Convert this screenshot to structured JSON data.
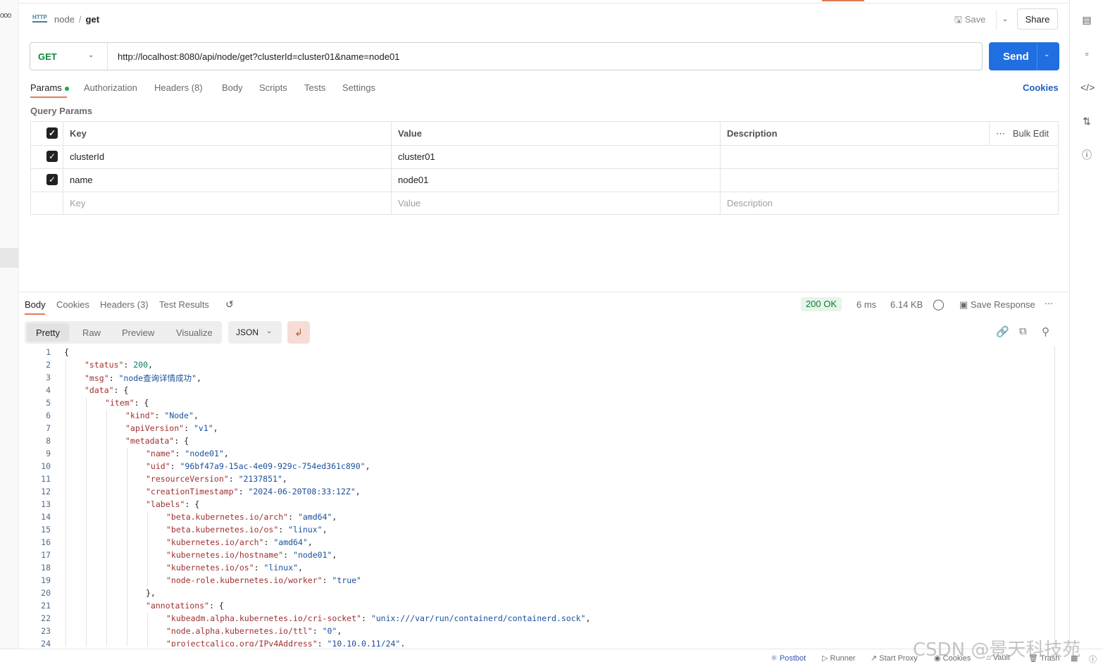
{
  "header": {
    "http_icon": "HTTP",
    "crumb_parent": "node",
    "crumb_sep": "/",
    "crumb_current": "get",
    "save_label": "Save",
    "share_label": "Share"
  },
  "request": {
    "method": "GET",
    "url": "http://localhost:8080/api/node/get?clusterId=cluster01&name=node01",
    "send_label": "Send",
    "tabs": [
      "Params",
      "Authorization",
      "Headers (8)",
      "Body",
      "Scripts",
      "Tests",
      "Settings"
    ],
    "cookies_label": "Cookies"
  },
  "params": {
    "title": "Query Params",
    "headers": [
      "Key",
      "Value",
      "Description"
    ],
    "bulk_edit": "Bulk Edit",
    "rows": [
      {
        "key": "clusterId",
        "value": "cluster01",
        "description": ""
      },
      {
        "key": "name",
        "value": "node01",
        "description": ""
      }
    ],
    "placeholder": {
      "key": "Key",
      "value": "Value",
      "description": "Description"
    }
  },
  "response": {
    "tabs": [
      "Body",
      "Cookies",
      "Headers (3)",
      "Test Results"
    ],
    "status": "200 OK",
    "time": "6 ms",
    "size": "6.14 KB",
    "save_response": "Save Response",
    "formats": [
      "Pretty",
      "Raw",
      "Preview",
      "Visualize"
    ],
    "format_type": "JSON"
  },
  "code_lines": [
    {
      "n": "1",
      "indent": 0,
      "html": "{"
    },
    {
      "n": "2",
      "indent": 1,
      "html": "<span class='k'>\"status\"</span>: <span class='n'>200</span>,"
    },
    {
      "n": "3",
      "indent": 1,
      "html": "<span class='k'>\"msg\"</span>: <span class='s'>\"node查询详情成功\"</span>,"
    },
    {
      "n": "4",
      "indent": 1,
      "html": "<span class='k'>\"data\"</span>: {"
    },
    {
      "n": "5",
      "indent": 2,
      "html": "<span class='k'>\"item\"</span>: {"
    },
    {
      "n": "6",
      "indent": 3,
      "html": "<span class='k'>\"kind\"</span>: <span class='s'>\"Node\"</span>,"
    },
    {
      "n": "7",
      "indent": 3,
      "html": "<span class='k'>\"apiVersion\"</span>: <span class='s'>\"v1\"</span>,"
    },
    {
      "n": "8",
      "indent": 3,
      "html": "<span class='k'>\"metadata\"</span>: {"
    },
    {
      "n": "9",
      "indent": 4,
      "html": "<span class='k'>\"name\"</span>: <span class='s'>\"node01\"</span>,"
    },
    {
      "n": "10",
      "indent": 4,
      "html": "<span class='k'>\"uid\"</span>: <span class='s'>\"96bf47a9-15ac-4e09-929c-754ed361c890\"</span>,"
    },
    {
      "n": "11",
      "indent": 4,
      "html": "<span class='k'>\"resourceVersion\"</span>: <span class='s'>\"2137851\"</span>,"
    },
    {
      "n": "12",
      "indent": 4,
      "html": "<span class='k'>\"creationTimestamp\"</span>: <span class='s'>\"2024-06-20T08:33:12Z\"</span>,"
    },
    {
      "n": "13",
      "indent": 4,
      "html": "<span class='k'>\"labels\"</span>: {"
    },
    {
      "n": "14",
      "indent": 5,
      "html": "<span class='k'>\"beta.kubernetes.io/arch\"</span>: <span class='s'>\"amd64\"</span>,"
    },
    {
      "n": "15",
      "indent": 5,
      "html": "<span class='k'>\"beta.kubernetes.io/os\"</span>: <span class='s'>\"linux\"</span>,"
    },
    {
      "n": "16",
      "indent": 5,
      "html": "<span class='k'>\"kubernetes.io/arch\"</span>: <span class='s'>\"amd64\"</span>,"
    },
    {
      "n": "17",
      "indent": 5,
      "html": "<span class='k'>\"kubernetes.io/hostname\"</span>: <span class='s'>\"node01\"</span>,"
    },
    {
      "n": "18",
      "indent": 5,
      "html": "<span class='k'>\"kubernetes.io/os\"</span>: <span class='s'>\"linux\"</span>,"
    },
    {
      "n": "19",
      "indent": 5,
      "html": "<span class='k'>\"node-role.kubernetes.io/worker\"</span>: <span class='s'>\"true\"</span>"
    },
    {
      "n": "20",
      "indent": 4,
      "html": "},"
    },
    {
      "n": "21",
      "indent": 4,
      "html": "<span class='k'>\"annotations\"</span>: {"
    },
    {
      "n": "22",
      "indent": 5,
      "html": "<span class='k'>\"kubeadm.alpha.kubernetes.io/cri-socket\"</span>: <span class='s'>\"unix:///var/run/containerd/containerd.sock\"</span>,"
    },
    {
      "n": "23",
      "indent": 5,
      "html": "<span class='k'>\"node.alpha.kubernetes.io/ttl\"</span>: <span class='s'>\"0\"</span>,"
    },
    {
      "n": "24",
      "indent": 5,
      "html": "<span class='k'>\"projectcalico.org/IPv4Address\"</span>: <span class='s'>\"10.10.0.11/24\"</span>,"
    }
  ],
  "footer": {
    "items": [
      "Postbot",
      "Runner",
      "Start Proxy",
      "Cookies",
      "Vault",
      "Trash"
    ]
  },
  "watermark": "CSDN @景天科技苑"
}
